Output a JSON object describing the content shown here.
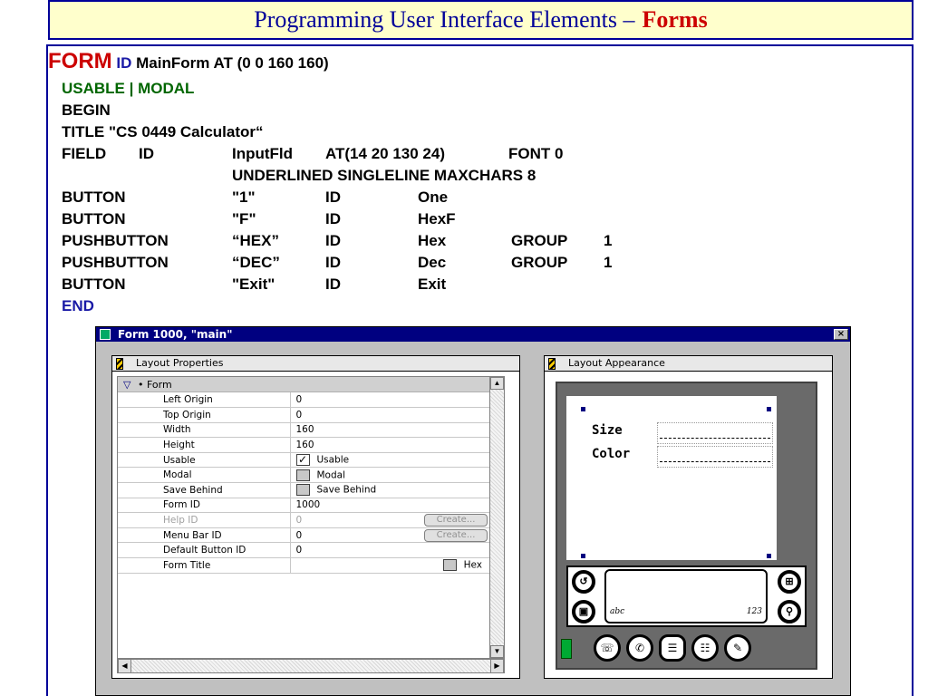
{
  "slide": {
    "title_main": "Programming User Interface Elements –",
    "title_accent": "Forms"
  },
  "code": {
    "line1": {
      "kw_form": "FORM",
      "kw_id": "ID",
      "rest": "MainForm AT (0 0 160 160)"
    },
    "line2": "USABLE | MODAL",
    "line3": "BEGIN",
    "line4": "TITLE \"CS 0449 Calculator“",
    "field": {
      "kw": "FIELD",
      "id": "ID",
      "name": "InputFld",
      "at": "AT(14  20   130  24)",
      "font": "FONT  0",
      "line2": "UNDERLINED  SINGLELINE    MAXCHARS 8"
    },
    "controls": [
      {
        "type": "BUTTON",
        "label": "\"1\"",
        "id": "ID",
        "name": "One",
        "group": "",
        "group_num": ""
      },
      {
        "type": "BUTTON",
        "label": "\"F\"",
        "id": "ID",
        "name": "HexF",
        "group": "",
        "group_num": ""
      },
      {
        "type": "PUSHBUTTON",
        "label": "“HEX”",
        "id": "ID",
        "name": "Hex",
        "group": "GROUP",
        "group_num": "1"
      },
      {
        "type": "PUSHBUTTON",
        "label": "“DEC”",
        "id": "ID",
        "name": "Dec",
        "group": "GROUP",
        "group_num": "1"
      },
      {
        "type": "BUTTON",
        "label": "\"Exit\"",
        "id": "ID",
        "name": "Exit",
        "group": "",
        "group_num": ""
      }
    ],
    "end": "END"
  },
  "window": {
    "title": "Form 1000, \"main\"",
    "close": "×"
  },
  "props_panel": {
    "title": "Layout Properties",
    "group": "• Form",
    "rows": [
      {
        "key": "Left Origin",
        "value": "0"
      },
      {
        "key": "Top Origin",
        "value": "0"
      },
      {
        "key": "Width",
        "value": "160"
      },
      {
        "key": "Height",
        "value": "160"
      },
      {
        "key": "Usable",
        "value": "Usable"
      },
      {
        "key": "Modal",
        "value": "Modal"
      },
      {
        "key": "Save Behind",
        "value": "Save Behind"
      },
      {
        "key": "Form ID",
        "value": "1000"
      },
      {
        "key": "Help ID",
        "value": "0"
      },
      {
        "key": "Menu Bar ID",
        "value": "0"
      },
      {
        "key": "Default Button ID",
        "value": "0"
      },
      {
        "key": "Form Title",
        "value": "Hex"
      }
    ],
    "create_label": "Create..."
  },
  "appear_panel": {
    "title": "Layout Appearance",
    "label_size": "Size",
    "label_color": "Color",
    "graffiti_left": "abc",
    "graffiti_right": "123"
  },
  "colors": {
    "title_bg": "#ffffcc",
    "title_text": "#000099",
    "accent": "#cc0000",
    "keyword_green": "#006600",
    "win_titlebar": "#000080"
  }
}
